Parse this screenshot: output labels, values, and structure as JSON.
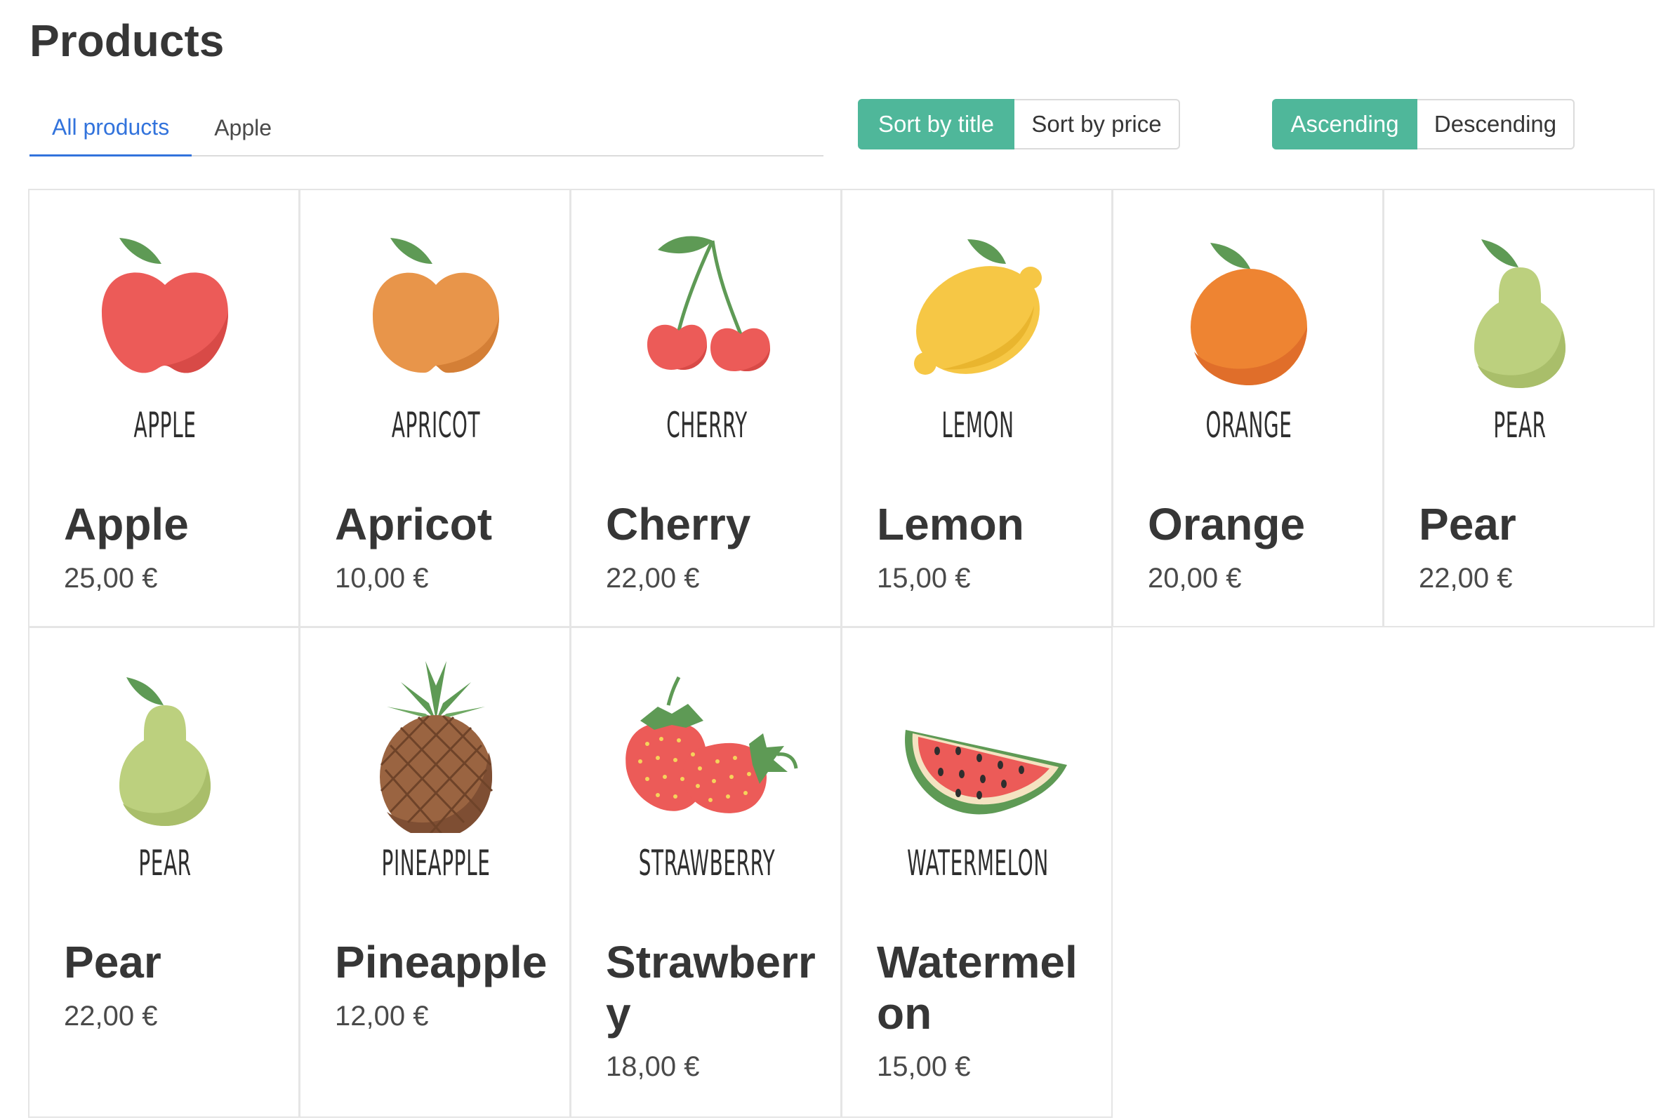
{
  "page": {
    "title": "Products"
  },
  "tabs": [
    {
      "label": "All products",
      "active": true
    },
    {
      "label": "Apple",
      "active": false
    }
  ],
  "sort": {
    "options": [
      {
        "label": "Sort by title",
        "selected": true
      },
      {
        "label": "Sort by price",
        "selected": false
      }
    ]
  },
  "order": {
    "options": [
      {
        "label": "Ascending",
        "selected": true
      },
      {
        "label": "Descending",
        "selected": false
      }
    ]
  },
  "colors": {
    "accent": "#4fb79a",
    "link": "#3273dc",
    "text": "#363636",
    "border": "#e5e5e5"
  },
  "products": [
    {
      "name": "Apple",
      "caption": "APPLE",
      "price": "25,00 €",
      "icon": "apple-icon"
    },
    {
      "name": "Apricot",
      "caption": "APRICOT",
      "price": "10,00 €",
      "icon": "apricot-icon"
    },
    {
      "name": "Cherry",
      "caption": "CHERRY",
      "price": "22,00 €",
      "icon": "cherry-icon"
    },
    {
      "name": "Lemon",
      "caption": "LEMON",
      "price": "15,00 €",
      "icon": "lemon-icon"
    },
    {
      "name": "Orange",
      "caption": "ORANGE",
      "price": "20,00 €",
      "icon": "orange-icon"
    },
    {
      "name": "Pear",
      "caption": "PEAR",
      "price": "22,00 €",
      "icon": "pear-icon"
    },
    {
      "name": "Pear",
      "caption": "PEAR",
      "price": "22,00 €",
      "icon": "pear-icon"
    },
    {
      "name": "Pineapple",
      "caption": "PINEAPPLE",
      "price": "12,00 €",
      "icon": "pineapple-icon"
    },
    {
      "name": "Strawberry",
      "caption": "STRAWBERRY",
      "price": "18,00 €",
      "icon": "strawberry-icon"
    },
    {
      "name": "Watermelon",
      "caption": "WATERMELON",
      "price": "15,00 €",
      "icon": "watermelon-icon"
    }
  ]
}
